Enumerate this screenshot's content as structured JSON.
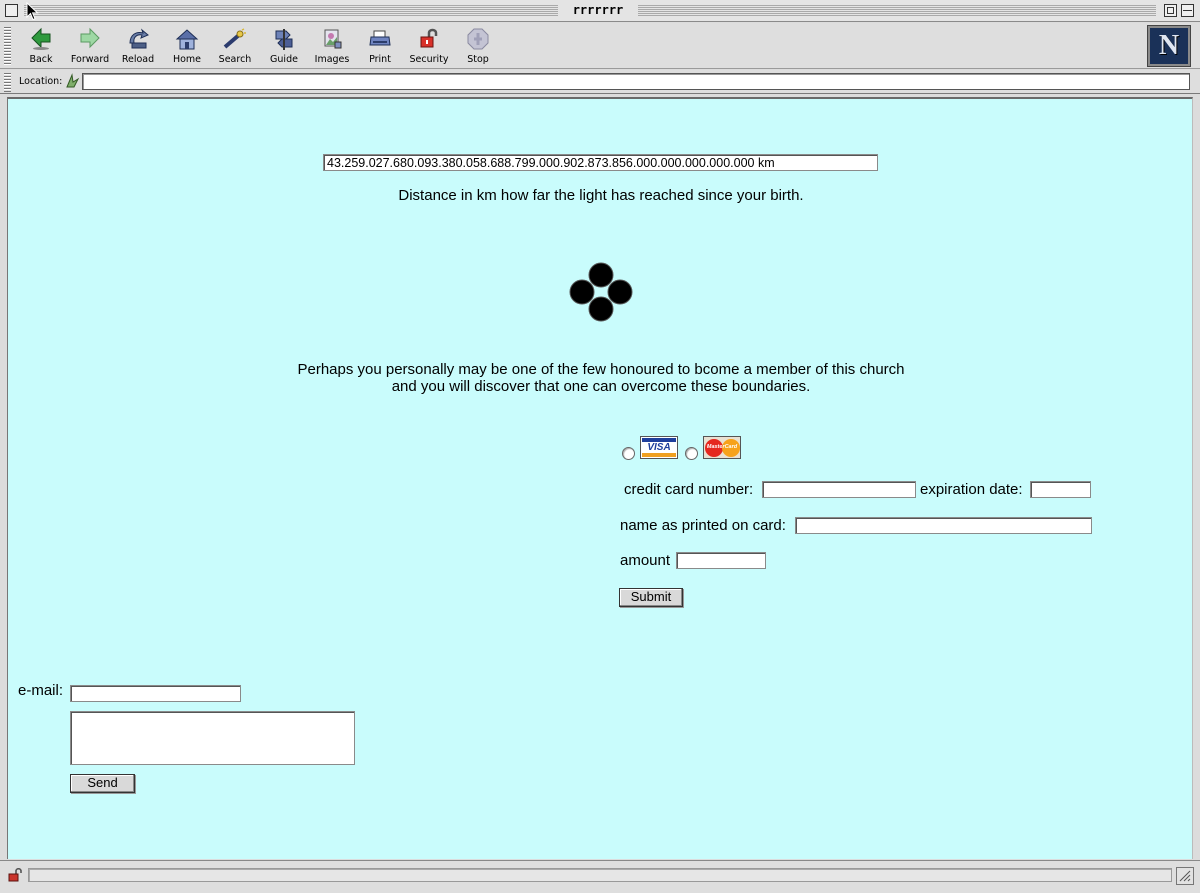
{
  "window": {
    "title": "rrrrrrr"
  },
  "toolbar": {
    "buttons": [
      {
        "label": "Back",
        "icon": "back-arrow-icon"
      },
      {
        "label": "Forward",
        "icon": "forward-arrow-icon"
      },
      {
        "label": "Reload",
        "icon": "reload-icon"
      },
      {
        "label": "Home",
        "icon": "home-icon"
      },
      {
        "label": "Search",
        "icon": "search-icon"
      },
      {
        "label": "Guide",
        "icon": "guide-icon"
      },
      {
        "label": "Images",
        "icon": "images-icon"
      },
      {
        "label": "Print",
        "icon": "print-icon"
      },
      {
        "label": "Security",
        "icon": "security-lock-icon"
      },
      {
        "label": "Stop",
        "icon": "stop-icon"
      }
    ],
    "logo_letter": "N"
  },
  "location": {
    "label": "Location:",
    "value": ""
  },
  "page": {
    "background": "#c9fcfc",
    "distance_value": "43.259.027.680.093.380.058.688.799.000.902.873.856.000.000.000.000.000 km",
    "distance_caption": "Distance in km how far the light has reached since your birth.",
    "message_line1": "Perhaps you personally may be one of the few honoured to bcome a member of this church",
    "message_line2": "and you will discover that one can overcome these boundaries.",
    "payment": {
      "card_options": [
        "VISA",
        "MasterCard"
      ],
      "card_number_label": "credit card number:",
      "card_number_value": "",
      "expiration_label": "expiration date:",
      "expiration_value": "",
      "name_label": "name as printed on card:",
      "name_value": "",
      "amount_label": "amount",
      "amount_value": "",
      "submit_label": "Submit"
    },
    "contact": {
      "email_label": "e-mail:",
      "email_value": "",
      "message_value": "",
      "send_label": "Send"
    }
  }
}
